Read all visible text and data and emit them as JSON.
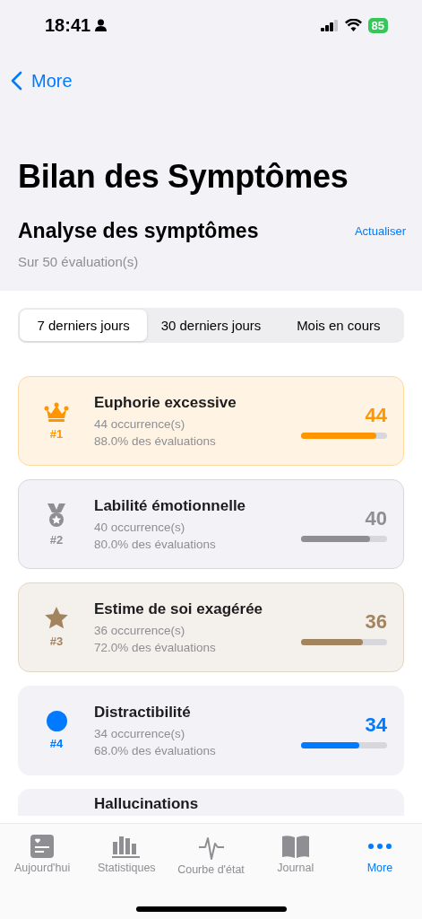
{
  "status_bar": {
    "time": "18:41",
    "battery": "85"
  },
  "nav": {
    "back_label": "More"
  },
  "title": "Bilan des Symptômes",
  "section": {
    "title": "Analyse des symptômes",
    "action": "Actualiser",
    "subtitle": "Sur 50 évaluation(s)"
  },
  "segments": [
    {
      "label": "7 derniers jours",
      "selected": true
    },
    {
      "label": "30 derniers jours",
      "selected": false
    },
    {
      "label": "Mois en cours",
      "selected": false
    }
  ],
  "symptoms": [
    {
      "kind": "crown",
      "rank": "#1",
      "name": "Euphorie excessive",
      "occurrences": "44 occurrence(s)",
      "percent": "88.0% des évaluations",
      "count": "44",
      "level": 0.88,
      "color": "#ff9500"
    },
    {
      "kind": "medal",
      "rank": "#2",
      "name": "Labilité émotionnelle",
      "occurrences": "40 occurrence(s)",
      "percent": "80.0% des évaluations",
      "count": "40",
      "level": 0.8,
      "color": "#8e8e93"
    },
    {
      "kind": "star",
      "rank": "#3",
      "name": "Estime de soi exagérée",
      "occurrences": "36 occurrence(s)",
      "percent": "72.0% des évaluations",
      "count": "36",
      "level": 0.72,
      "color": "#a2845e"
    },
    {
      "kind": "dot",
      "rank": "#4",
      "name": "Distractibilité",
      "occurrences": "34 occurrence(s)",
      "percent": "68.0% des évaluations",
      "count": "34",
      "level": 0.68,
      "color": "#007aff"
    },
    {
      "kind": "partial",
      "name": "Hallucinations"
    }
  ],
  "tabs": [
    {
      "label": "Aujourd'hui",
      "kind": "card",
      "selected": false
    },
    {
      "label": "Statistiques",
      "kind": "bars",
      "selected": false
    },
    {
      "label": "Courbe d'état",
      "kind": "pulse",
      "selected": false
    },
    {
      "label": "Journal",
      "kind": "book",
      "selected": false
    },
    {
      "label": "More",
      "kind": "dots",
      "selected": true
    }
  ]
}
